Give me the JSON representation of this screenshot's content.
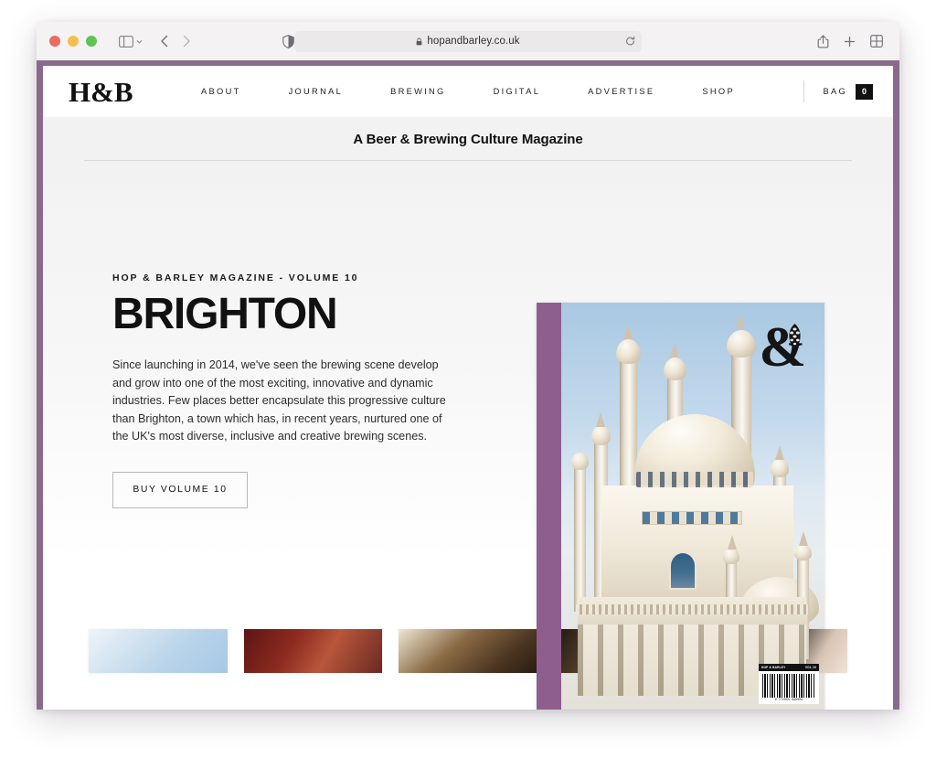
{
  "browser": {
    "url": "hopandbarley.co.uk",
    "traffic_lights": [
      "close",
      "minimize",
      "maximize"
    ],
    "icons": {
      "sidebar": "sidebar-icon",
      "sidebar_chevron": "chevron-down-icon",
      "back": "back-arrow-icon",
      "forward": "forward-arrow-icon",
      "reader_privacy": "privacy-shield-icon",
      "lock": "lock-icon",
      "reload": "reload-icon",
      "share": "share-icon",
      "new_tab": "plus-icon",
      "tab_overview": "tab-overview-icon"
    }
  },
  "site": {
    "logo": "H&B",
    "nav": [
      {
        "label": "ABOUT"
      },
      {
        "label": "JOURNAL"
      },
      {
        "label": "BREWING"
      },
      {
        "label": "DIGITAL"
      },
      {
        "label": "ADVERTISE"
      },
      {
        "label": "SHOP"
      }
    ],
    "bag": {
      "label": "BAG",
      "count": "0"
    },
    "tagline": "A Beer & Brewing Culture Magazine"
  },
  "hero": {
    "eyebrow": "HOP & BARLEY MAGAZINE - VOLUME 10",
    "title": "BRIGHTON",
    "body": "Since launching in 2014, we've seen the brewing scene develop and grow into one of the most exciting, innovative and dynamic industries. Few places better encapsulate this progressive culture than Brighton, a town which has, in recent years, nurtured one of the UK's most diverse, inclusive and creative brewing scenes.",
    "cta": "BUY VOLUME 10"
  },
  "cover": {
    "alt": "Brighton Royal Pavilion magazine cover",
    "logo": "&",
    "barcode": {
      "title": "HOP & BARLEY",
      "volume": "VOL 10",
      "number": "9 772050 990009"
    }
  },
  "thumbnails": [
    {
      "name": "thumbnail-sky"
    },
    {
      "name": "thumbnail-portrait-red"
    },
    {
      "name": "thumbnail-bar-interior"
    },
    {
      "name": "thumbnail-brewer-portrait"
    },
    {
      "name": "thumbnail-dark-hands"
    }
  ],
  "colors": {
    "frame_purple": "#8a6a8b",
    "spine_purple": "#8e5f8e",
    "band_gray": "#f2f2f2",
    "text_black": "#111111"
  }
}
